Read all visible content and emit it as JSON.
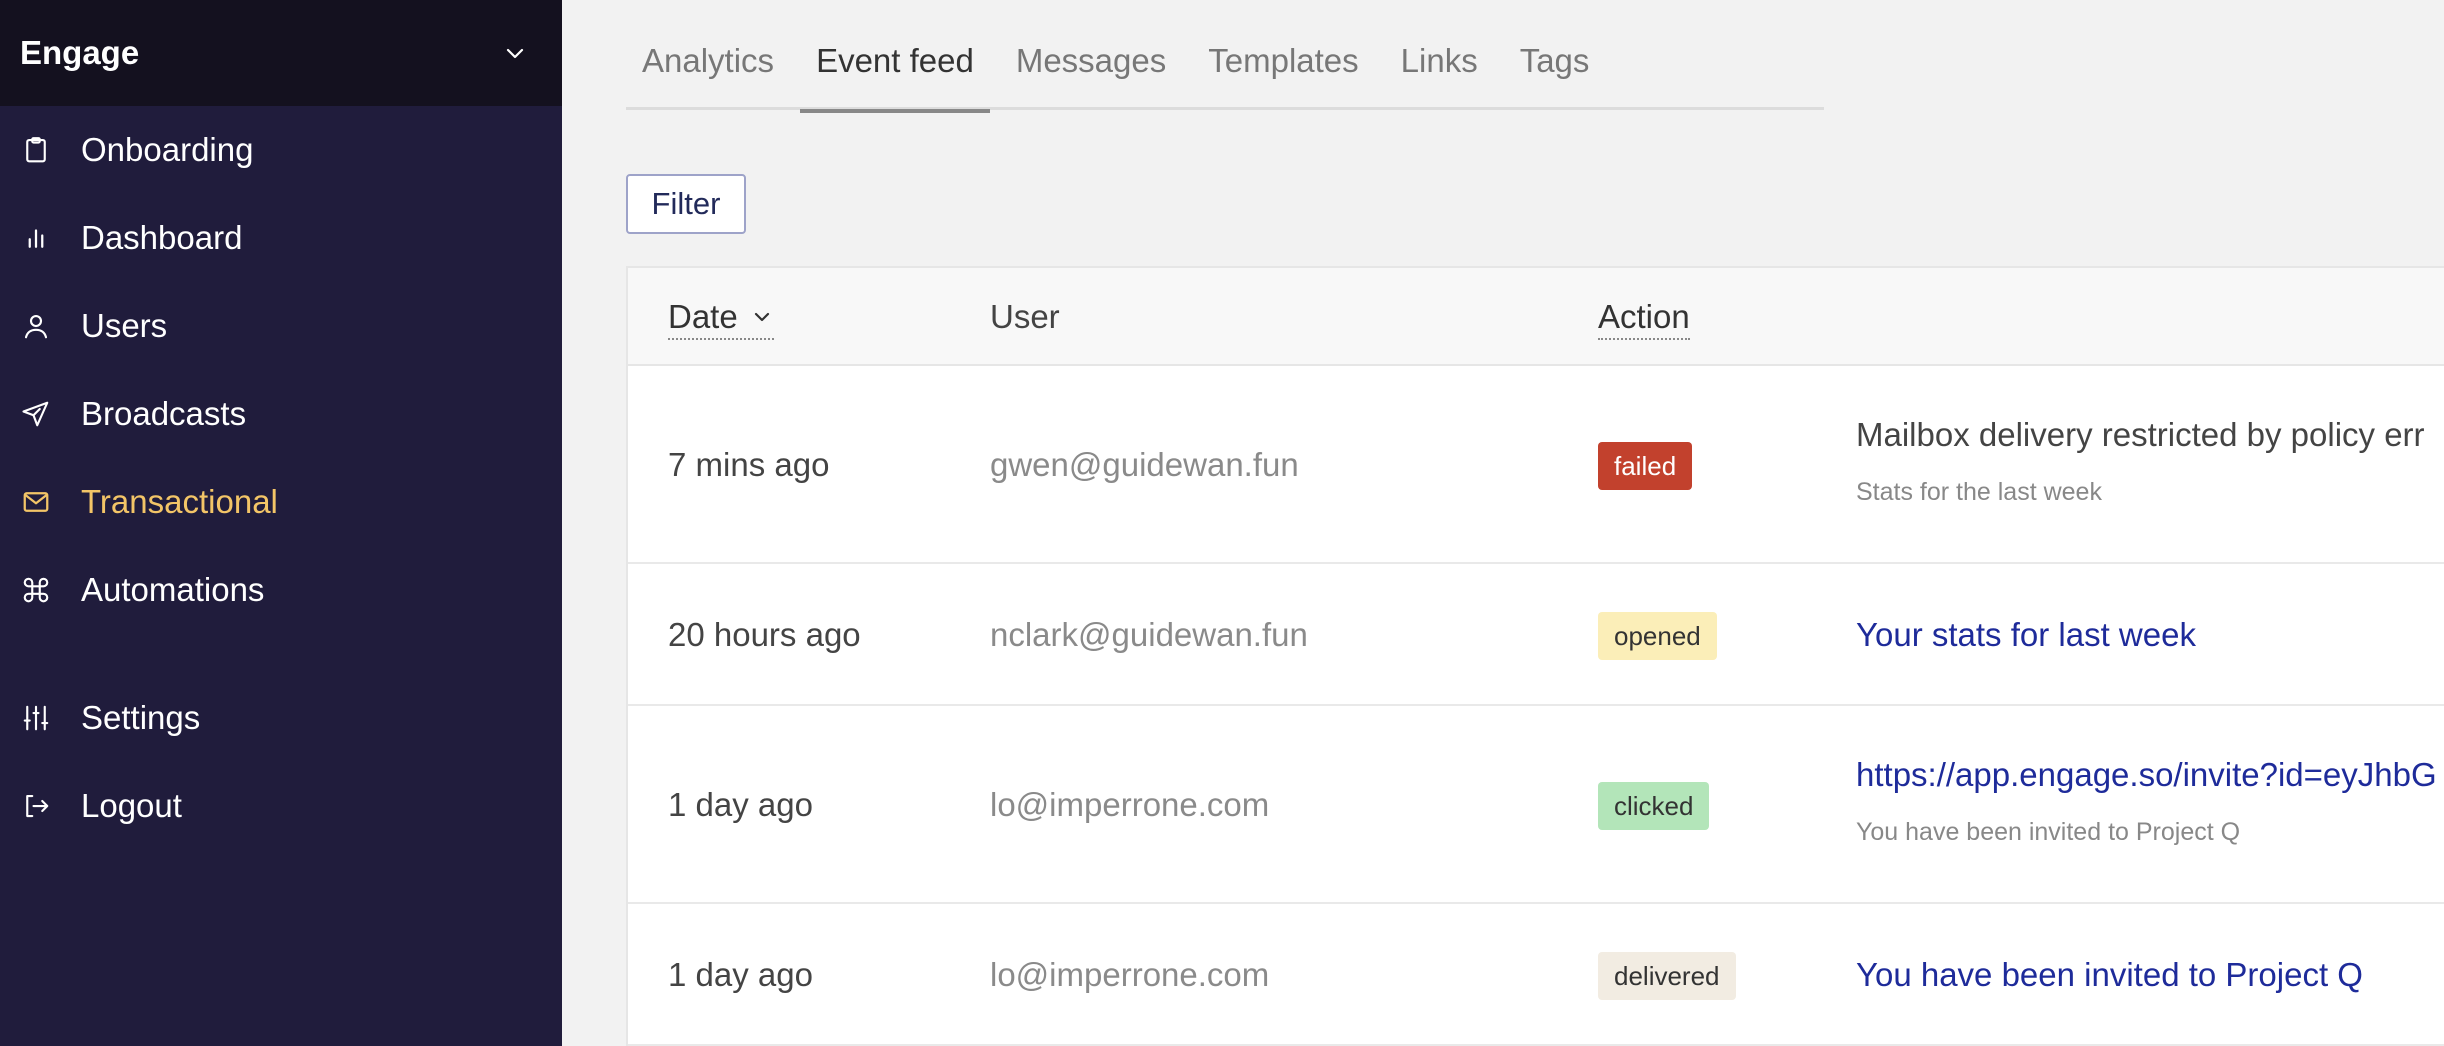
{
  "app": {
    "brand": "Engage"
  },
  "sidebar": {
    "items": [
      {
        "label": "Onboarding",
        "icon": "clipboard-icon"
      },
      {
        "label": "Dashboard",
        "icon": "bar-chart-icon"
      },
      {
        "label": "Users",
        "icon": "user-icon"
      },
      {
        "label": "Broadcasts",
        "icon": "send-icon"
      },
      {
        "label": "Transactional",
        "icon": "mail-icon",
        "active": true
      },
      {
        "label": "Automations",
        "icon": "command-icon"
      },
      {
        "label": "Settings",
        "icon": "sliders-icon"
      },
      {
        "label": "Logout",
        "icon": "logout-icon"
      }
    ]
  },
  "tabs": [
    {
      "label": "Analytics"
    },
    {
      "label": "Event feed",
      "active": true
    },
    {
      "label": "Messages"
    },
    {
      "label": "Templates"
    },
    {
      "label": "Links"
    },
    {
      "label": "Tags"
    }
  ],
  "filter_label": "Filter",
  "table": {
    "columns": {
      "date": "Date",
      "user": "User",
      "action": "Action"
    },
    "rows": [
      {
        "date": "7 mins ago",
        "user": "gwen@guidewan.fun",
        "action": "failed",
        "title": "Mailbox delivery restricted by policy err",
        "subtitle": "Stats for the last week"
      },
      {
        "date": "20 hours ago",
        "user": "nclark@guidewan.fun",
        "action": "opened",
        "title": "Your stats for last week",
        "subtitle": ""
      },
      {
        "date": "1 day ago",
        "user": "lo@imperrone.com",
        "action": "clicked",
        "title": "https://app.engage.so/invite?id=eyJhbG",
        "subtitle": "You have been invited to Project Q"
      },
      {
        "date": "1 day ago",
        "user": "lo@imperrone.com",
        "action": "delivered",
        "title": "You have been invited to Project Q",
        "subtitle": ""
      }
    ]
  },
  "colors": {
    "sidebar_bg": "#201c3c",
    "brand_bg": "#14111f",
    "active_nav": "#f3c567",
    "link": "#1e2b9a",
    "failed": "#c2412d",
    "opened": "#fbeeb8",
    "clicked": "#b3e5b9",
    "delivered": "#f2ece2"
  }
}
